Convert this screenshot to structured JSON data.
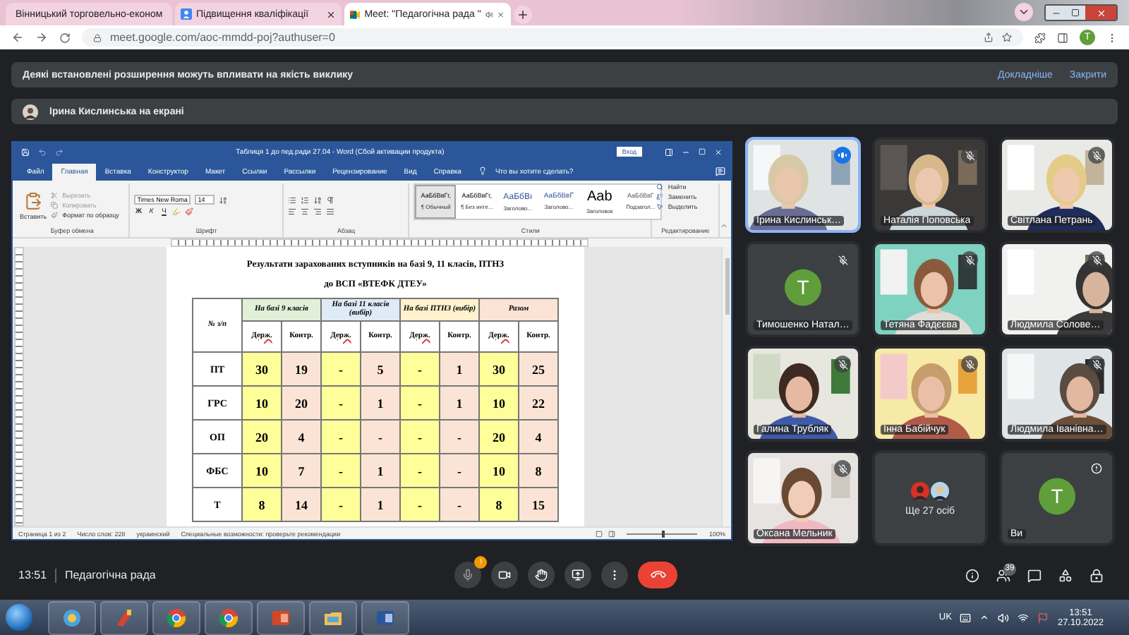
{
  "browser": {
    "tabs": [
      {
        "title": "Вінницький торговельно-економ",
        "selected": false,
        "kind": "calendar"
      },
      {
        "title": "Підвищення кваліфікації",
        "selected": false,
        "kind": "person"
      },
      {
        "title": "Meet: \"Педагогічна рада \"",
        "selected": true,
        "kind": "meet",
        "audio": true
      }
    ],
    "url": "meet.google.com/aoc-mmdd-poj?authuser=0",
    "profile_letter": "T"
  },
  "banner": {
    "text": "Деякі встановлені розширення можуть впливати на якість виклику",
    "links": [
      "Докладніше",
      "Закрити"
    ]
  },
  "presenter": {
    "text": "Ірина Кислинська на екрані"
  },
  "word": {
    "title": "Таблиця 1 до пед.ради 27.04 - Word (Сбой активации продукта)",
    "sign_in": "Вход",
    "menu": [
      {
        "label": "Файл",
        "selected": false
      },
      {
        "label": "Главная",
        "selected": true
      },
      {
        "label": "Вставка",
        "selected": false
      },
      {
        "label": "Конструктор",
        "selected": false
      },
      {
        "label": "Макет",
        "selected": false
      },
      {
        "label": "Ссылки",
        "selected": false
      },
      {
        "label": "Рассылки",
        "selected": false
      },
      {
        "label": "Рецензирование",
        "selected": false
      },
      {
        "label": "Вид",
        "selected": false
      },
      {
        "label": "Справка",
        "selected": false
      }
    ],
    "tell_me": "Что вы хотите сделать?",
    "clipboard": {
      "paste": "Вставить",
      "items": [
        "Вырезать",
        "Копировать",
        "Формат по образцу"
      ],
      "label": "Буфер обмена"
    },
    "font": {
      "name": "Times New Roma",
      "size": "14",
      "buttons": [
        "Ж",
        "К",
        "Ч"
      ],
      "label": "Шрифт"
    },
    "paragraph": {
      "label": "Абзац"
    },
    "styles": {
      "label": "Стили",
      "items": [
        {
          "sample": "АаБбВвГг,",
          "name": "¶ Обычный",
          "kind": "normal",
          "selected": true
        },
        {
          "sample": "АаБбВвГг,",
          "name": "¶ Без инте...",
          "kind": "normal",
          "selected": false
        },
        {
          "sample": "АаБбВı",
          "name": "Заголово...",
          "kind": "heading",
          "selected": false
        },
        {
          "sample": "АаБбВвГ",
          "name": "Заголово...",
          "kind": "heading2",
          "selected": false
        },
        {
          "sample": "Aab",
          "name": "Заголовок",
          "kind": "title",
          "selected": false
        },
        {
          "sample": "АаБбВвГ",
          "name": "Подзагол...",
          "kind": "subtitle",
          "selected": false
        }
      ]
    },
    "editing": {
      "label": "Редактирование",
      "items": [
        "Найти",
        "Заменить",
        "Выделить"
      ]
    },
    "document": {
      "title": [
        "Результати зарахованих вступників на базі 9, 11 класів, ПТНЗ",
        "до ВСП «ВТЕФК ДТЕУ»"
      ],
      "table": {
        "corner": "№ з/п",
        "groups": [
          {
            "label": "На базі 9 класів",
            "color": "#e2efd9"
          },
          {
            "label": "На базі 11 класів (вибір)",
            "color": "#deeaf6"
          },
          {
            "label": "На базі ПТНЗ (вибір)",
            "color": "#fff2cc"
          },
          {
            "label": "Разом",
            "color": "#fbe4d5"
          }
        ],
        "columns": [
          {
            "label": "Держ.",
            "color": "#ffff99"
          },
          {
            "label": "Контр.",
            "color": "#fbe4d5"
          },
          {
            "label": "Держ.",
            "color": "#ffff99"
          },
          {
            "label": "Контр.",
            "color": "#fbe4d5"
          },
          {
            "label": "Держ.",
            "color": "#ffff99"
          },
          {
            "label": "Контр.",
            "color": "#fbe4d5"
          },
          {
            "label": "Держ.",
            "color": "#ffff99"
          },
          {
            "label": "Контр.",
            "color": "#fbe4d5"
          }
        ],
        "rows": [
          {
            "label": "ПТ",
            "cells": [
              "30",
              "19",
              "-",
              "5",
              "-",
              "1",
              "30",
              "25"
            ]
          },
          {
            "label": "ГРС",
            "cells": [
              "10",
              "20",
              "-",
              "1",
              "-",
              "1",
              "10",
              "22"
            ]
          },
          {
            "label": "ОП",
            "cells": [
              "20",
              "4",
              "-",
              "-",
              "-",
              "-",
              "20",
              "4"
            ]
          },
          {
            "label": "ФБС",
            "cells": [
              "10",
              "7",
              "-",
              "1",
              "-",
              "-",
              "10",
              "8"
            ]
          },
          {
            "label": "Т",
            "cells": [
              "8",
              "14",
              "-",
              "1",
              "-",
              "-",
              "8",
              "15"
            ]
          }
        ]
      }
    },
    "status": [
      "Страница 1 из 2",
      "Число слов: 228",
      "украинский",
      "Специальные возможности: проверьте рекомендации"
    ],
    "zoom": {
      "text": "100%",
      "level": 0.5
    }
  },
  "tiles": [
    {
      "kind": "video",
      "name": "Ірина Кислинськ…",
      "muted": false,
      "speaking": true,
      "selected": true
    },
    {
      "kind": "video",
      "name": "Наталія Поповська",
      "muted": true,
      "speaking": false,
      "selected": false
    },
    {
      "kind": "video",
      "name": "Світлана Петрань",
      "muted": true,
      "speaking": false,
      "selected": false
    },
    {
      "kind": "avatar",
      "name": "Тимошенко Натал…",
      "letter": "T",
      "muted": true,
      "speaking": false,
      "selected": false
    },
    {
      "kind": "video",
      "name": "Тетяна Фадєєва",
      "muted": true,
      "speaking": false,
      "selected": false
    },
    {
      "kind": "video",
      "name": "Людмила Солове…",
      "muted": true,
      "speaking": false,
      "selected": false
    },
    {
      "kind": "video",
      "name": "Галина Трубляк",
      "muted": true,
      "speaking": false,
      "selected": false
    },
    {
      "kind": "video",
      "name": "Інна Бабійчук",
      "muted": true,
      "speaking": false,
      "selected": false
    },
    {
      "kind": "video",
      "name": "Людмила Іванівна…",
      "muted": true,
      "speaking": false,
      "selected": false
    },
    {
      "kind": "video",
      "name": "Оксана Мельник",
      "muted": true,
      "speaking": false,
      "selected": false
    },
    {
      "kind": "more",
      "name": "Ще 27 осіб",
      "muted": false,
      "speaking": false,
      "selected": false
    },
    {
      "kind": "avatar",
      "name": "Ви",
      "letter": "T",
      "muted": false,
      "alert": true,
      "speaking": false,
      "selected": false
    }
  ],
  "call_bar": {
    "time": "13:51",
    "title": "Педагогічна рада",
    "mic_badge": "!",
    "people_count": "39"
  },
  "taskbar": {
    "language": "UK",
    "time": "13:51",
    "date": "27.10.2022"
  }
}
